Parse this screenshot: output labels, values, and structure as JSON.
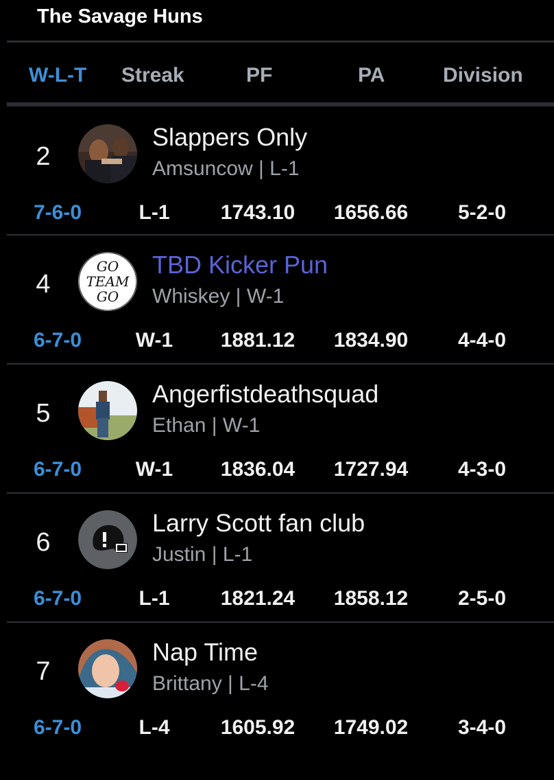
{
  "league_title": "The Savage Huns",
  "columns": [
    "W-L-T",
    "Streak",
    "PF",
    "PA",
    "Division"
  ],
  "active_column": "W-L-T",
  "teams": [
    {
      "rank": "2",
      "name": "Slappers Only",
      "owner_line": "Amsuncow | L-1",
      "wlt": "7-6-0",
      "streak": "L-1",
      "pf": "1743.10",
      "pa": "1656.66",
      "division": "5-2-0",
      "avatar": "photo-avatar"
    },
    {
      "rank": "4",
      "name": "TBD Kicker Pun",
      "owner_line": "Whiskey | W-1",
      "wlt": "6-7-0",
      "streak": "W-1",
      "pf": "1881.12",
      "pa": "1834.90",
      "division": "4-4-0",
      "avatar": "go-team-go-avatar",
      "avatar_text": [
        "GO",
        "TEAM",
        "GO"
      ]
    },
    {
      "rank": "5",
      "name": "Angerfistdeathsquad",
      "owner_line": "Ethan | W-1",
      "wlt": "6-7-0",
      "streak": "W-1",
      "pf": "1836.04",
      "pa": "1727.94",
      "division": "4-3-0",
      "avatar": "photo-avatar"
    },
    {
      "rank": "6",
      "name": "Larry Scott fan club",
      "owner_line": "Justin | L-1",
      "wlt": "6-7-0",
      "streak": "L-1",
      "pf": "1821.24",
      "pa": "1858.12",
      "division": "2-5-0",
      "avatar": "helmet-avatar"
    },
    {
      "rank": "7",
      "name": "Nap Time",
      "owner_line": "Brittany | L-4",
      "wlt": "6-7-0",
      "streak": "L-4",
      "pf": "1605.92",
      "pa": "1749.02",
      "division": "3-4-0",
      "avatar": "cartoon-avatar"
    }
  ],
  "colors": {
    "background": "#000000",
    "accent_blue": "#3b8fd8",
    "link_purple": "#5b63d8",
    "muted_text": "#9ea3aa"
  }
}
